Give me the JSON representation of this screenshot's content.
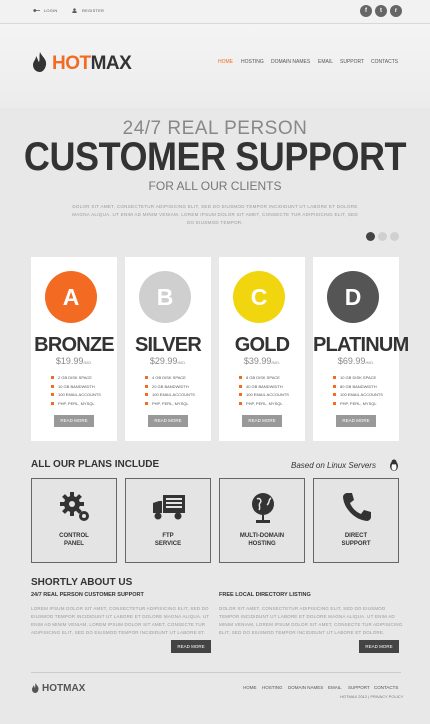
{
  "topbar": {
    "login": "LOGIN",
    "register": "REGISTER",
    "social": [
      {
        "name": "facebook-icon",
        "glyph": "f"
      },
      {
        "name": "twitter-icon",
        "glyph": "t"
      },
      {
        "name": "rss-icon",
        "glyph": "r"
      }
    ]
  },
  "brand": {
    "hot": "HOT",
    "max": "MAX",
    "accent": "#f36b22"
  },
  "nav": [
    "HOME",
    "HOSTING",
    "DOMAIN NAMES",
    "EMAIL",
    "SUPPORT",
    "CONTACTS"
  ],
  "hero": {
    "line1": "24/7 REAL PERSON",
    "line2": "CUSTOMER SUPPORT",
    "line3": "FOR ALL OUR CLIENTS",
    "text": "DOLOR SIT AMET, CONSECTETUR ADIPISICING ELIT, SED DO EIUSMOD TEMPOR INCIDIDUNT UT LABORE ET DOLORE MAGNA ALIQUA. UT ENIM AD MINIM VENIAM, LOREM IPSUM DOLOR SIT AMET, CONSECTE TUR ADIPISICING ELIT, SED DO EIUSMOD TEMPOR."
  },
  "plans": [
    {
      "letter": "A",
      "name": "BRONZE",
      "price": "$19.99",
      "unit": "/MO.",
      "color": "#f36b22",
      "features": [
        "2 GB DISK SPACE",
        "10 GB BANDWIDTH",
        "100 EMAIL ACCOUNTS",
        "PHP, PERL, MYSQL"
      ]
    },
    {
      "letter": "B",
      "name": "SILVER",
      "price": "$29.99",
      "unit": "/MO.",
      "color": "#cfcfcf",
      "features": [
        "4 GB DISK SPACE",
        "20 GB BANDWIDTH",
        "100 EMAIL ACCOUNTS",
        "PHP, PERL, MYSQL"
      ]
    },
    {
      "letter": "C",
      "name": "GOLD",
      "price": "$39.99",
      "unit": "/MO.",
      "color": "#f1d60f",
      "features": [
        "8 GB DISK SPACE",
        "40 GB BANDWIDTH",
        "100 EMAIL ACCOUNTS",
        "PHP, PERL, MYSQL"
      ]
    },
    {
      "letter": "D",
      "name": "PLATINUM",
      "price": "$69.99",
      "unit": "/MO.",
      "color": "#555555",
      "features": [
        "10 GB DISK SPACE",
        "80 GB BANDWIDTH",
        "100 EMAIL ACCOUNTS",
        "PHP, PERL, MYSQL"
      ]
    }
  ],
  "read_more": "READ MORE",
  "plans_include": {
    "title": "ALL OUR PLANS INCLUDE",
    "linux": "Based on Linux Servers",
    "items": [
      {
        "icon": "gears-icon",
        "label1": "CONTROL",
        "label2": "PANEL"
      },
      {
        "icon": "truck-icon",
        "label1": "FTP",
        "label2": "SERVICE"
      },
      {
        "icon": "globe-icon",
        "label1": "MULTI-DOMAIN",
        "label2": "HOSTING"
      },
      {
        "icon": "phone-icon",
        "label1": "DIRECT",
        "label2": "SUPPORT"
      }
    ]
  },
  "about": {
    "title": "SHORTLY ABOUT US",
    "col1": {
      "heading": "24/7 REAL PERSON CUSTOMER SUPPORT",
      "text": "LOREM IPSUM DOLOR SIT AMET, CONSECTETUR ADIPISICING ELIT, SED DO EIUSMOD TEMPOR INCIDIDUNT UT LABORE ET DOLORE MAGNA ALIQUA. UT ENIM AD MINIM VENIAM, LOREM IPSUM DOLOR SIT AMET, CONSECTE TUR ADIPISICING ELIT, SED DO EIUSMOD TEMPOR INCIDIDUNT UT LABORE ET."
    },
    "col2": {
      "heading": "FREE LOCAL DIRECTORY LISTING",
      "text": "DOLOR SIT AMET, CONSECTETUR ADIPISICING ELIT, SED DO EIUSMOD TEMPOR INCIDIDUNT UT LABORE ET DOLORE MAGNA ALIQUA. UT ENIM AD MINIM VENIAM, LOREM IPSUM DOLOR SIT AMET, CONSECTE TUR ADIPISICING ELIT, SED DO EIUSMOD TEMPOR INCIDIDUNT UT LABORE ET DOLORE."
    }
  },
  "footer": {
    "nav": [
      "HOME",
      "HOSTING",
      "DOMAIN NAMES",
      "EMAIL",
      "SUPPORT",
      "CONTACTS"
    ],
    "copyright": "HOTMAX 2012 | PRIVACY POLICY"
  }
}
